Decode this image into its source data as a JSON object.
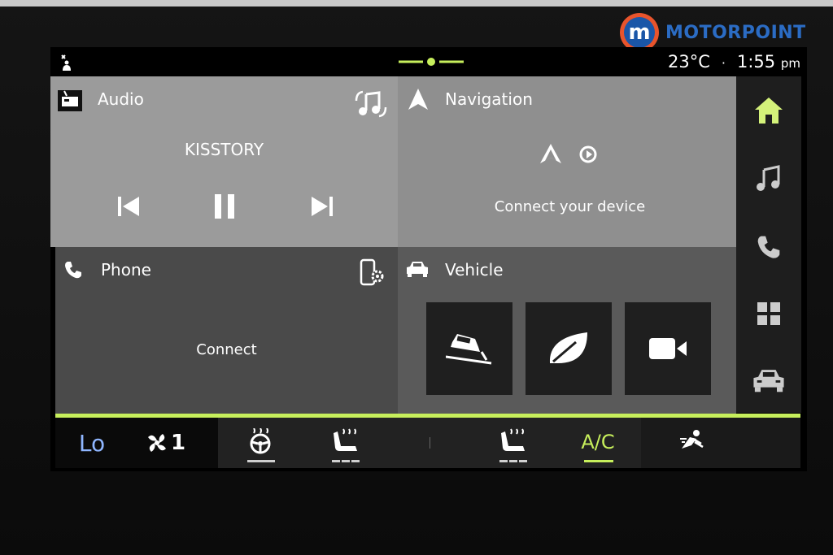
{
  "brand": {
    "initial": "m",
    "name": "MOTORPOINT"
  },
  "status": {
    "temperature": "23°C",
    "separator": "·",
    "time": "1:55",
    "ampm": "pm"
  },
  "tiles": {
    "audio": {
      "title": "Audio",
      "station": "KISSTORY"
    },
    "navigation": {
      "title": "Navigation",
      "message": "Connect your device"
    },
    "phone": {
      "title": "Phone",
      "message": "Connect"
    },
    "vehicle": {
      "title": "Vehicle"
    }
  },
  "climate": {
    "temp_label": "Lo",
    "fan_level": "1",
    "ac_label": "A/C"
  },
  "colors": {
    "accent_green": "#c7ef5c",
    "temp_blue": "#8fb6ff",
    "brand_blue": "#2b6cc4",
    "brand_orange": "#e8542c"
  },
  "icons": {
    "status": "passenger-airbag-off-icon",
    "audio": "radio-icon",
    "audio_source": "music-source-switch-icon",
    "navigation": "navigation-arrow-icon",
    "android_auto": "android-auto-icon",
    "carplay": "carplay-icon",
    "phone": "phone-icon",
    "phone_settings": "phone-settings-icon",
    "vehicle": "car-icon",
    "hill_descent": "hill-descent-icon",
    "eco": "leaf-icon",
    "camera": "camera-icon",
    "rail": [
      "home-icon",
      "music-icon",
      "phone-icon",
      "apps-grid-icon",
      "car-icon"
    ],
    "climate": [
      "fan-icon",
      "heated-steering-wheel-icon",
      "heated-seat-left-icon",
      "heated-seat-right-icon",
      "air-direction-icon"
    ]
  }
}
